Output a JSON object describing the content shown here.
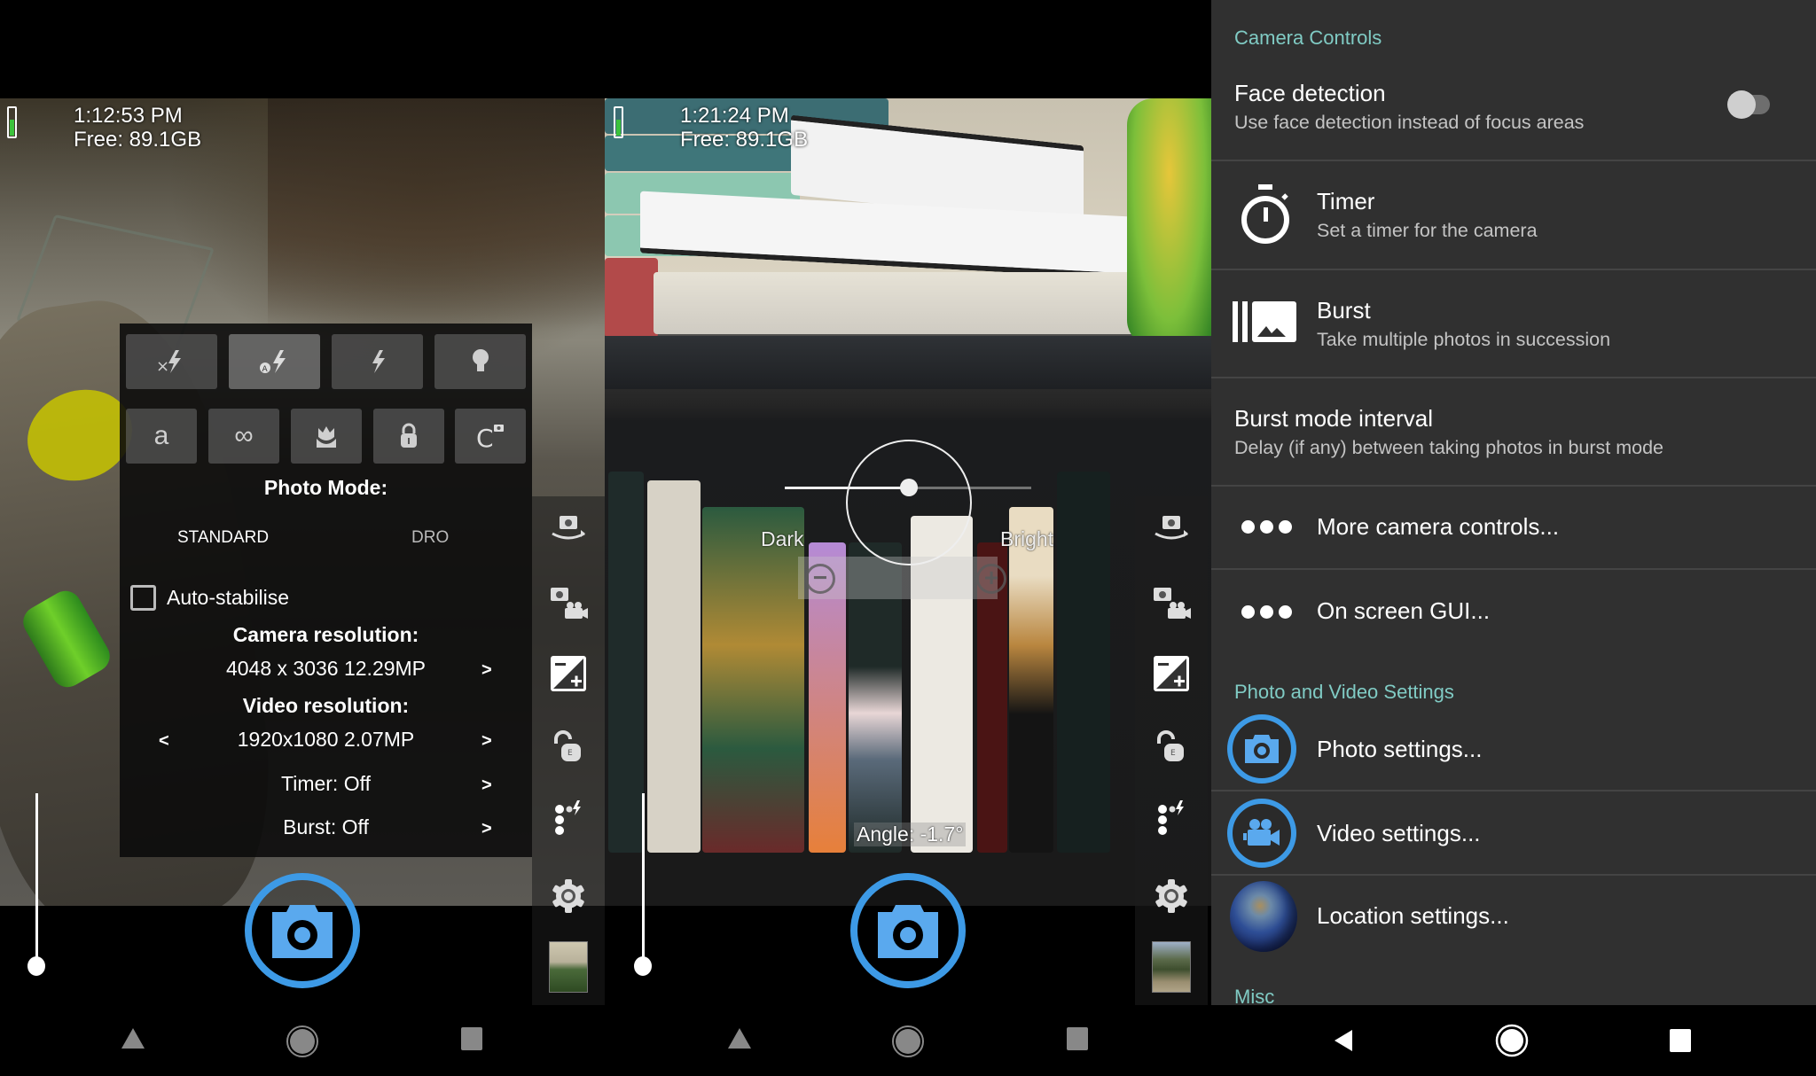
{
  "screens": [
    {
      "time": "1:12:53 PM",
      "free_space": "Free: 89.1GB",
      "battery_level": 0.55,
      "popup": {
        "flash_options": [
          {
            "icon": "flash-off-icon",
            "glyph": "×ϟ",
            "selected": false
          },
          {
            "icon": "flash-auto-icon",
            "glyph": "ᴬϟ",
            "selected": true
          },
          {
            "icon": "flash-on-icon",
            "glyph": "ϟ",
            "selected": false
          },
          {
            "icon": "torch-icon",
            "glyph": "💡",
            "selected": false
          }
        ],
        "focus_options": [
          {
            "icon": "focus-auto-icon",
            "glyph": "a"
          },
          {
            "icon": "focus-infinity-icon",
            "glyph": "∞"
          },
          {
            "icon": "focus-macro-icon",
            "glyph": "❀"
          },
          {
            "icon": "focus-locked-icon",
            "glyph": "🔒"
          },
          {
            "icon": "focus-continuous-icon",
            "glyph": "C"
          }
        ],
        "photo_mode_label": "Photo Mode:",
        "photo_modes": [
          "STANDARD",
          "DRO"
        ],
        "photo_mode_selected": "STANDARD",
        "auto_stabilise_label": "Auto-stabilise",
        "auto_stabilise_checked": false,
        "camera_resolution_label": "Camera resolution:",
        "camera_resolution_value": "4048 x 3036 12.29MP",
        "video_resolution_label": "Video resolution:",
        "video_resolution_value": "1920x1080 2.07MP",
        "timer_value": "Timer: Off",
        "burst_value": "Burst: Off",
        "prev_arrow": "<",
        "next_arrow": ">"
      },
      "zoom_level": 0
    },
    {
      "time": "1:21:24 PM",
      "free_space": "Free: 89.1GB",
      "battery_level": 0.55,
      "exposure": {
        "dark_label": "Dark",
        "bright_label": "Bright",
        "minus": "−",
        "plus": "+",
        "level": 0.5
      },
      "angle": "Angle: -1.7°",
      "zoom_level": 0
    }
  ],
  "sidebar_icons": [
    "switch-camera-icon",
    "switch-video-icon",
    "exposure-icon",
    "exposure-lock-icon",
    "popup-menu-icon",
    "settings-icon",
    "gallery-thumbnail"
  ],
  "nav": {
    "back": "back-icon",
    "home": "home-icon",
    "recents": "recents-icon"
  },
  "settings": {
    "section_camera_controls": "Camera Controls",
    "face_detection_title": "Face detection",
    "face_detection_summary": "Use face detection instead of focus areas",
    "face_detection_enabled": false,
    "timer_title": "Timer",
    "timer_summary": "Set a timer for the camera",
    "burst_title": "Burst",
    "burst_summary": "Take multiple photos in succession",
    "burst_interval_title": "Burst mode interval",
    "burst_interval_summary": "Delay (if any) between taking photos in burst mode",
    "more_controls": "More camera controls...",
    "on_screen_gui": "On screen GUI...",
    "section_photo_video": "Photo and Video Settings",
    "photo_settings": "Photo settings...",
    "video_settings": "Video settings...",
    "location_settings": "Location settings...",
    "section_misc": "Misc"
  },
  "colors": {
    "accent": "#3d9ae6",
    "section_header": "#80cbc4",
    "settings_bg": "#303030"
  }
}
